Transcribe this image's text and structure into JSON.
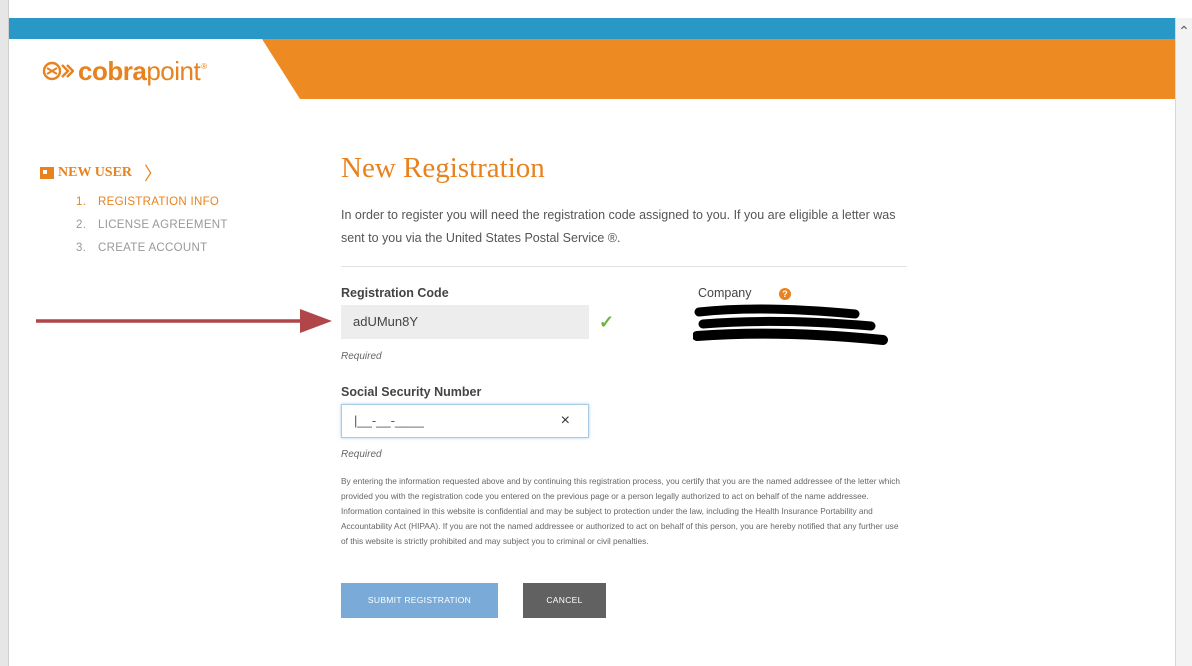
{
  "brand": {
    "logo_bold": "cobra",
    "logo_light": "point",
    "trademark": "®",
    "accent": "#e8821e",
    "header_blue": "#2998c6"
  },
  "sidebar": {
    "heading": "NEW USER",
    "chevron": "〉",
    "steps": [
      {
        "num": "1.",
        "label": "REGISTRATION INFO",
        "active": true
      },
      {
        "num": "2.",
        "label": "LICENSE AGREEMENT",
        "active": false
      },
      {
        "num": "3.",
        "label": "CREATE ACCOUNT",
        "active": false
      }
    ]
  },
  "page": {
    "title": "New Registration",
    "intro": "In order to register you will need the registration code assigned to you. If you are eligible a letter was sent to you via the United States Postal Service ®."
  },
  "form": {
    "registration_code": {
      "label": "Registration Code",
      "value": "adUMun8Y",
      "required_text": "Required",
      "valid_icon": "checkmark-icon"
    },
    "company": {
      "label": "Company",
      "help_icon": "?",
      "value_redacted": true
    },
    "ssn": {
      "label": "Social Security Number",
      "value": "|__-__-____",
      "required_text": "Required",
      "clear_icon": "×"
    }
  },
  "legal_text": "By entering the information requested above and by continuing this registration process, you certify that you are the named addressee of the letter which provided you with the registration code you entered on the previous page or a person legally authorized to act on behalf of the name addressee. Information contained in this website is confidential and may be subject to protection under the law, including the Health Insurance Portability and Accountability Act (HIPAA). If you are not the named addressee or authorized to act on behalf of this person, you are hereby notified that any further use of this website is strictly prohibited and may subject you to criminal or civil penalties.",
  "buttons": {
    "submit": "SUBMIT REGISTRATION",
    "cancel": "CANCEL"
  }
}
